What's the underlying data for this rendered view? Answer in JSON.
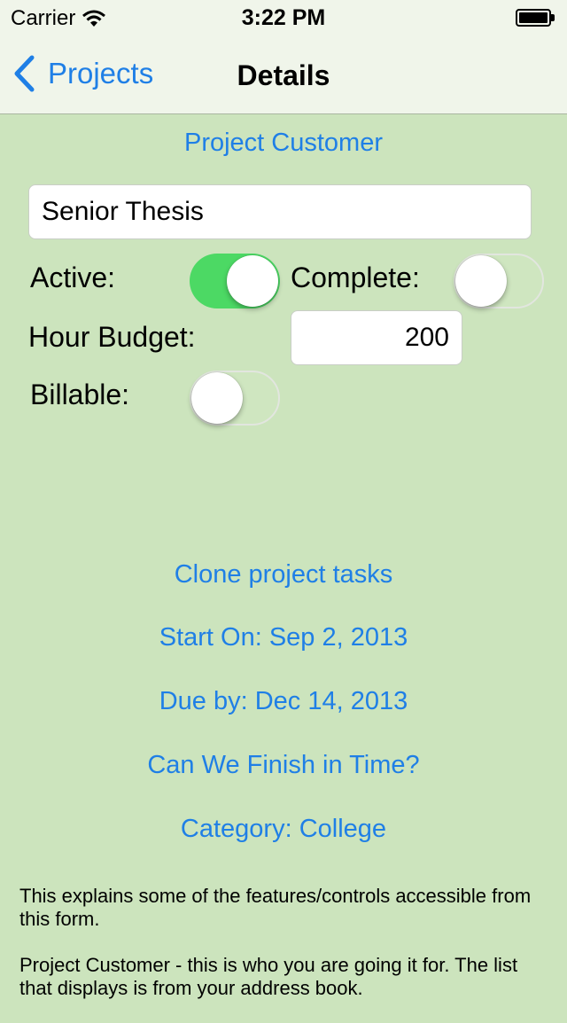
{
  "status_bar": {
    "carrier": "Carrier",
    "time": "3:22 PM",
    "wifi_icon": "wifi-icon",
    "battery_icon": "battery-icon"
  },
  "nav": {
    "back_label": "Projects",
    "back_icon": "chevron-left-icon",
    "title": "Details"
  },
  "form": {
    "project_customer": "Project Customer",
    "project_name": "Senior Thesis",
    "active_label": "Active:",
    "active_on": true,
    "complete_label": "Complete:",
    "complete_on": false,
    "hour_budget_label": "Hour Budget:",
    "hour_budget_value": "200",
    "billable_label": "Billable:",
    "billable_on": false
  },
  "actions": {
    "clone_tasks": "Clone project tasks",
    "start_on": "Start On: Sep 2, 2013",
    "due_by": "Due by: Dec 14, 2013",
    "can_we_finish": "Can We Finish in Time?",
    "category": "Category: College"
  },
  "help": {
    "paragraph1": "This explains some of the features/controls accessible from this form.",
    "paragraph2": "Project Customer - this is who you are going it for. The list that displays is from your address book."
  },
  "colors": {
    "background": "#cce4bd",
    "accent": "#1f7fe6",
    "toggle_on": "#4cd964"
  }
}
